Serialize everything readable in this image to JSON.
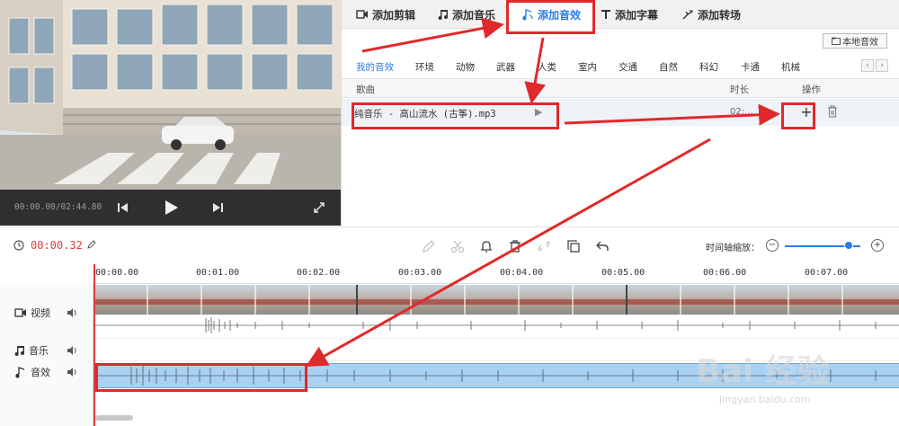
{
  "preview": {
    "time": "00:00.00/02:44.80"
  },
  "tabs": [
    {
      "label": "添加剪辑",
      "icon": "video-icon",
      "active": false
    },
    {
      "label": "添加音乐",
      "icon": "music-note-icon",
      "active": false
    },
    {
      "label": "添加音效",
      "icon": "sound-effect-icon",
      "active": true
    },
    {
      "label": "添加字幕",
      "icon": "text-icon",
      "active": false
    },
    {
      "label": "添加转场",
      "icon": "transition-icon",
      "active": false
    }
  ],
  "local_button": "本地音效",
  "categories": [
    "我的音效",
    "环境",
    "动物",
    "武器",
    "人类",
    "室内",
    "交通",
    "自然",
    "科幻",
    "卡通",
    "机械"
  ],
  "list": {
    "headers": {
      "song": "歌曲",
      "duration": "时长",
      "action": "操作"
    },
    "rows": [
      {
        "name": "纯音乐 - 高山流水 (古筝).mp3",
        "duration": "02:..."
      }
    ],
    "add_symbol": "+"
  },
  "toolbar": {
    "current_time": "00:00.32",
    "zoom_label": "时间轴缩放：",
    "zoom_minus": "−",
    "zoom_plus": "+",
    "zoom_level": 0.85
  },
  "ruler": [
    "00:00.00",
    "00:01.00",
    "00:02.00",
    "00:03.00",
    "00:04.00",
    "00:05.00",
    "00:06.00",
    "00:07.00"
  ],
  "tracks": {
    "video": "视频",
    "music": "音乐",
    "effect": "音效"
  },
  "watermark": {
    "main": "Bai 经验",
    "sub": "jingyan.baidu.com"
  },
  "colors": {
    "accent": "#2b7de9",
    "annotation": "#e0292b",
    "time": "#e23b3b"
  }
}
